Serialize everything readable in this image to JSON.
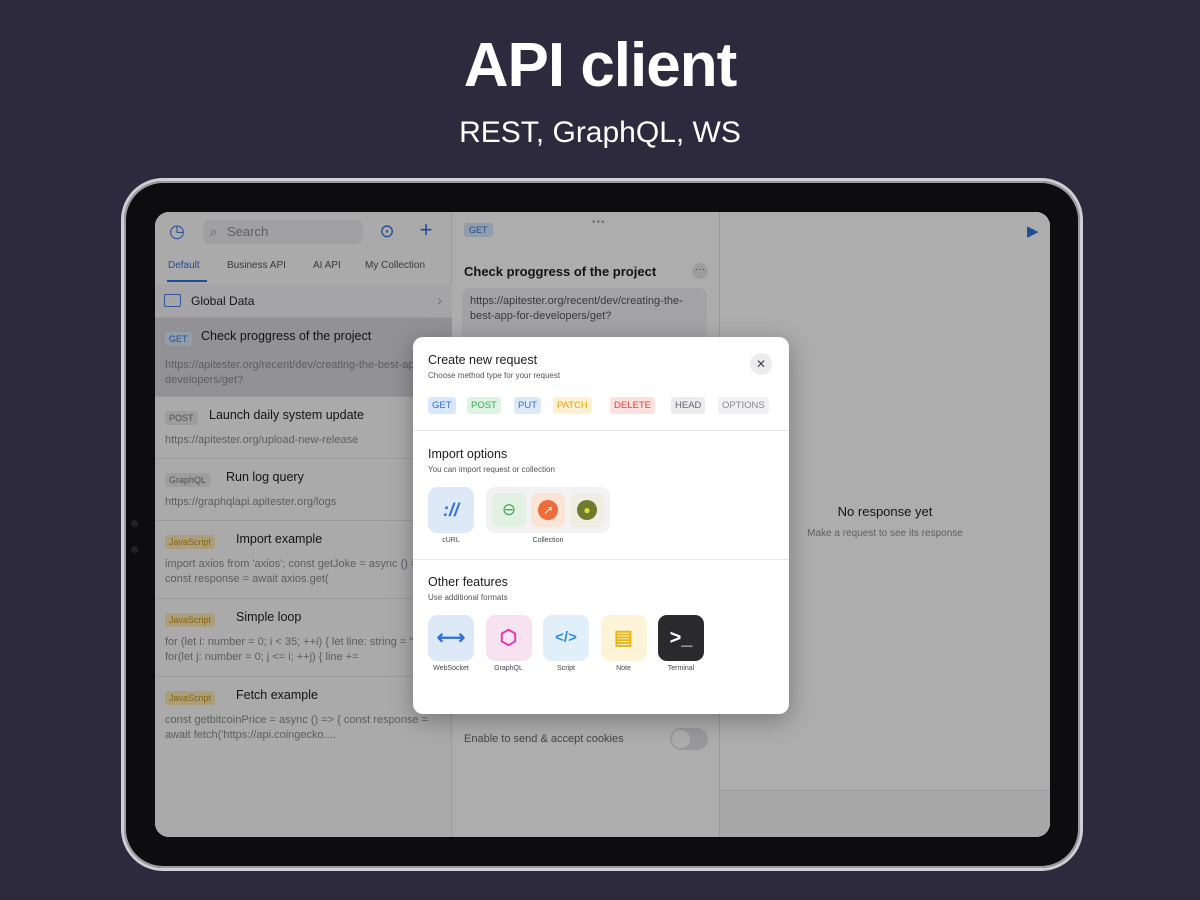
{
  "hero": {
    "title": "API client",
    "subtitle": "REST, GraphQL, WS"
  },
  "left": {
    "search_placeholder": "Search",
    "tabs": [
      "Default",
      "Business API",
      "AI API",
      "My Collection"
    ],
    "global_data": "Global Data",
    "requests": [
      {
        "method": "GET",
        "title": "Check proggress of the project",
        "body": "https://apitester.org/recent/dev/creating-the-best-app-for-developers/get?"
      },
      {
        "method": "POST",
        "title": "Launch daily system update",
        "body": "https://apitester.org/upload-new-release"
      },
      {
        "method": "GraphQL",
        "title": "Run log query",
        "body": "https://graphqlapi.apitester.org/logs"
      },
      {
        "method": "JavaScript",
        "title": "Import example",
        "body": "import axios from 'axios'; const getJoke = async () => { const response = await axios.get("
      },
      {
        "method": "JavaScript",
        "title": "Simple loop",
        "body": "for (let i: number = 0; i < 35; ++i) { let line: string = \"\"; for(let j: number = 0; j <= i; ++j) { line +="
      },
      {
        "method": "JavaScript",
        "title": "Fetch example",
        "body": "const getbitcoinPrice = async () => { const response = await fetch('https://api.coingecko...."
      }
    ]
  },
  "middle": {
    "method": "GET",
    "title": "Check proggress of the project",
    "more": "···",
    "url": "https://apitester.org/recent/dev/creating-the-best-app-for-developers/get?",
    "cookies_label": "Enable to send & accept cookies"
  },
  "right": {
    "no_response": "No response yet",
    "no_response_sub": "Make a request to see its response"
  },
  "modal": {
    "title": "Create new request",
    "subtitle": "Choose method type for your request",
    "close": "✕",
    "methods": [
      {
        "label": "GET",
        "color": "#2f6fe0",
        "bg": "#d8e7fb"
      },
      {
        "label": "POST",
        "color": "#34a853",
        "bg": "#dff3e4"
      },
      {
        "label": "PUT",
        "color": "#2f6fe0",
        "bg": "#dde9f7"
      },
      {
        "label": "PATCH",
        "color": "#e0a412",
        "bg": "#fdf1d2"
      },
      {
        "label": "DELETE",
        "color": "#e0453a",
        "bg": "#fbe1df"
      },
      {
        "label": "HEAD",
        "color": "#666666",
        "bg": "#ececee"
      },
      {
        "label": "OPTIONS",
        "color": "#888888",
        "bg": "#f1f1f3"
      }
    ],
    "import_title": "Import options",
    "import_sub": "You can import request or collection",
    "import_curl_label": "cURL",
    "import_collection_label": "Collection",
    "import_curl_glyph": "://",
    "other_title": "Other features",
    "other_sub": "Use additional formats",
    "features": [
      {
        "label": "WebSocket",
        "glyph": "⟷",
        "fg": "#2f6fe0",
        "bg": "#dde9f7",
        "icon": "websocket-icon"
      },
      {
        "label": "GraphQL",
        "glyph": "⬡",
        "fg": "#e535ab",
        "bg": "#f6e3ef",
        "icon": "graphql-icon"
      },
      {
        "label": "Script",
        "glyph": "</>",
        "fg": "#2f8fe0",
        "bg": "#e1effa",
        "icon": "script-icon"
      },
      {
        "label": "Note",
        "glyph": "▤",
        "fg": "#e8b517",
        "bg": "#fdf3d6",
        "icon": "note-icon"
      },
      {
        "label": "Terminal",
        "glyph": ">_",
        "fg": "#ffffff",
        "bg": "#2a2a2c",
        "icon": "terminal-icon"
      }
    ]
  }
}
